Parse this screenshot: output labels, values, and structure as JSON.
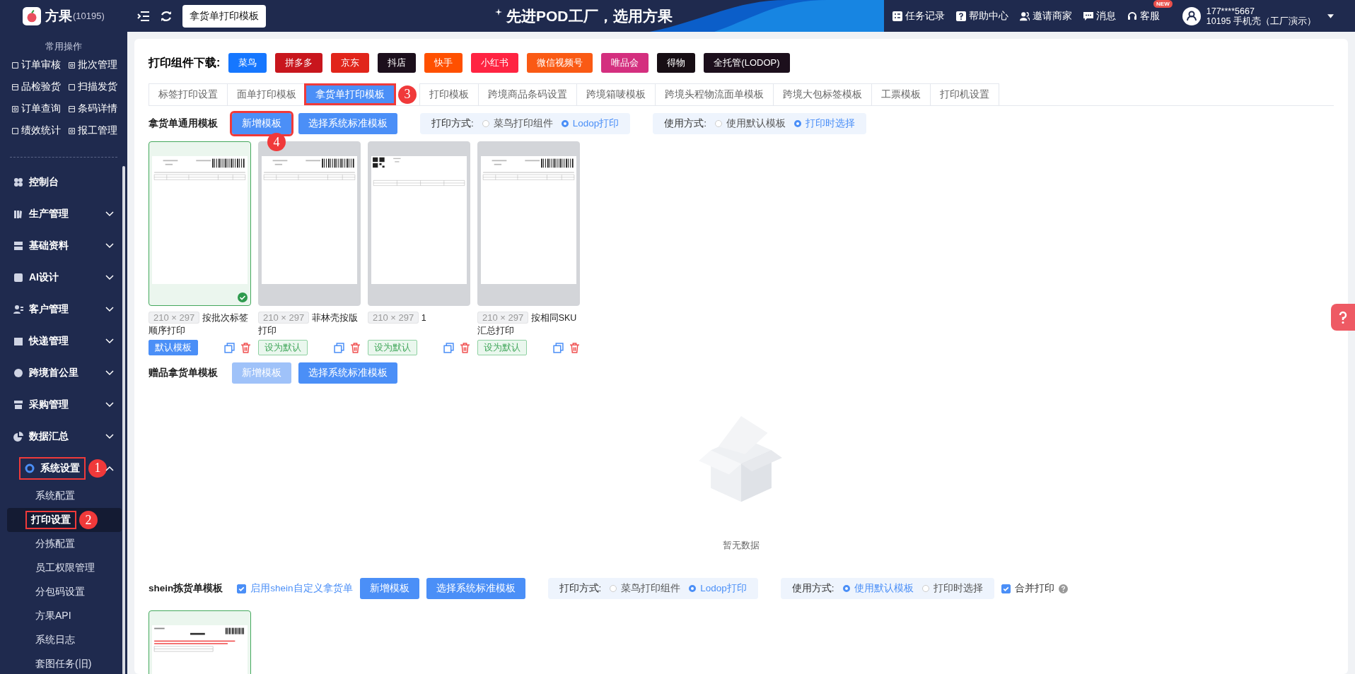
{
  "header": {
    "logo_text": "方果",
    "account_id": "(10195)",
    "page_tab": "拿货单打印模板",
    "slogan": "先进POD工厂，选用方果",
    "links": [
      {
        "label": "任务记录",
        "kind": "tasks"
      },
      {
        "label": "帮助中心",
        "kind": "help"
      },
      {
        "label": "邀请商家",
        "kind": "invite"
      },
      {
        "label": "消息",
        "kind": "message"
      },
      {
        "label": "客服",
        "kind": "service",
        "badge": "NEW"
      }
    ],
    "user": {
      "phone": "177****5667",
      "org": "10195 手机壳（工厂演示）"
    }
  },
  "sidebar": {
    "quick_title": "常用操作",
    "quick": [
      "订单审核",
      "批次管理",
      "品检验货",
      "扫描发货",
      "订单查询",
      "条码详情",
      "绩效统计",
      "报工管理"
    ],
    "menu": [
      {
        "label": "控制台",
        "kind": "link"
      },
      {
        "label": "生产管理",
        "kind": "group",
        "expanded": false
      },
      {
        "label": "基础资料",
        "kind": "group",
        "expanded": false
      },
      {
        "label": "AI设计",
        "kind": "group",
        "expanded": false
      },
      {
        "label": "客户管理",
        "kind": "group",
        "expanded": false
      },
      {
        "label": "快递管理",
        "kind": "group",
        "expanded": false
      },
      {
        "label": "跨境首公里",
        "kind": "group",
        "expanded": false
      },
      {
        "label": "采购管理",
        "kind": "group",
        "expanded": false
      },
      {
        "label": "数据汇总",
        "kind": "group",
        "expanded": false
      },
      {
        "label": "系统设置",
        "kind": "group",
        "expanded": true,
        "step": "1",
        "children": [
          {
            "label": "系统配置",
            "selected": false
          },
          {
            "label": "打印设置",
            "selected": true,
            "step": "2"
          },
          {
            "label": "分拣配置",
            "selected": false
          },
          {
            "label": "员工权限管理",
            "selected": false
          },
          {
            "label": "分包码设置",
            "selected": false
          },
          {
            "label": "方果API",
            "selected": false
          },
          {
            "label": "系统日志",
            "selected": false
          },
          {
            "label": "套图任务(旧)",
            "selected": false
          }
        ]
      }
    ]
  },
  "downloads": {
    "label": "打印组件下载:",
    "buttons": [
      {
        "label": "菜鸟",
        "color": "#1677ff"
      },
      {
        "label": "拼多多",
        "color": "#c8161d"
      },
      {
        "label": "京东",
        "color": "#e1251b"
      },
      {
        "label": "抖店",
        "color": "#1c0f1c"
      },
      {
        "label": "快手",
        "color": "#ff5000"
      },
      {
        "label": "小红书",
        "color": "#ff2442"
      },
      {
        "label": "微信视频号",
        "color": "#fa5a14"
      },
      {
        "label": "唯品会",
        "color": "#d42f7f"
      },
      {
        "label": "得物",
        "color": "#170e14"
      },
      {
        "label": "全托管(LODOP)",
        "color": "#1c0f1c"
      }
    ]
  },
  "tabs": [
    {
      "label": "标签打印设置",
      "selected": false
    },
    {
      "label": "面单打印模板",
      "selected": false
    },
    {
      "label": "拿货单打印模板",
      "selected": true,
      "step": "3"
    },
    {
      "label": "打印模板",
      "selected": false
    },
    {
      "label": "跨境商品条码设置",
      "selected": false
    },
    {
      "label": "跨境箱唛模板",
      "selected": false
    },
    {
      "label": "跨境头程物流面单模板",
      "selected": false
    },
    {
      "label": "跨境大包标签模板",
      "selected": false
    },
    {
      "label": "工票模板",
      "selected": false
    },
    {
      "label": "打印机设置",
      "selected": false
    }
  ],
  "sections": [
    {
      "title": "拿货单通用模板",
      "add_button": {
        "label": "新增模板",
        "disabled": false,
        "step": "4"
      },
      "standard_button": "选择系统标准模板",
      "print_mode": {
        "label": "打印方式:",
        "options": [
          {
            "label": "菜鸟打印组件",
            "selected": false
          },
          {
            "label": "Lodop打印",
            "selected": true
          }
        ]
      },
      "use_mode": {
        "label": "使用方式:",
        "options": [
          {
            "label": "使用默认模板",
            "selected": false
          },
          {
            "label": "打印时选择",
            "selected": true
          }
        ]
      },
      "templates": [
        {
          "size": "210 × 297",
          "name": "按批次标签顺序打印",
          "selected": true,
          "default_button": "默认模板"
        },
        {
          "size": "210 × 297",
          "name": "菲林壳按版打印",
          "selected": false,
          "default_button": "设为默认"
        },
        {
          "size": "210 × 297",
          "name": "1",
          "selected": false,
          "default_button": "设为默认"
        },
        {
          "size": "210 × 297",
          "name": "按相同SKU汇总打印",
          "selected": false,
          "default_button": "设为默认"
        }
      ]
    },
    {
      "title": "赠品拿货单模板",
      "add_button": {
        "label": "新增模板",
        "disabled": true
      },
      "standard_button": "选择系统标准模板",
      "empty_text": "暂无数据"
    },
    {
      "title": "shein拣货单模板",
      "enable_checkbox": {
        "label": "启用shein自定义拿货单",
        "checked": true
      },
      "add_button": {
        "label": "新增模板",
        "disabled": false
      },
      "standard_button": "选择系统标准模板",
      "print_mode": {
        "label": "打印方式:",
        "options": [
          {
            "label": "菜鸟打印组件",
            "selected": false
          },
          {
            "label": "Lodop打印",
            "selected": true
          }
        ]
      },
      "use_mode": {
        "label": "使用方式:",
        "options": [
          {
            "label": "使用默认模板",
            "selected": true
          },
          {
            "label": "打印时选择",
            "selected": false
          }
        ]
      },
      "merge_checkbox": {
        "label": "合并打印",
        "checked": true
      },
      "templates": [
        {
          "selected": true
        }
      ]
    }
  ]
}
